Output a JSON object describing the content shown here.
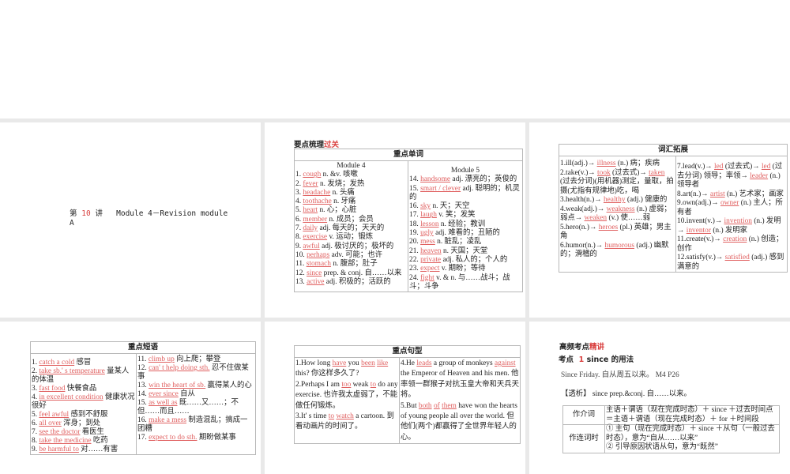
{
  "slide1": {
    "prefix": "第",
    "num": "10",
    "mid": "讲",
    "title": "Module 4－Revision module",
    "title2": "A"
  },
  "slide2": {
    "heading": "要点梳理",
    "heading_red": "过关",
    "table_title": "重点单词",
    "col1_head": "Module 4",
    "col2_head": "Module 5",
    "col1": [
      [
        {
          "t": "1. "
        },
        {
          "t": "cough",
          "r": 1
        },
        {
          "t": "  n. &v. 咳嗽"
        }
      ],
      [
        {
          "t": "2. "
        },
        {
          "t": "fever",
          "r": 1
        },
        {
          "t": "  n. 发烧；发热"
        }
      ],
      [
        {
          "t": "3. "
        },
        {
          "t": "headache",
          "r": 1
        },
        {
          "t": " n. 头痛"
        }
      ],
      [
        {
          "t": "4. "
        },
        {
          "t": "toothache",
          "r": 1
        },
        {
          "t": "  n. 牙痛"
        }
      ],
      [
        {
          "t": "5. "
        },
        {
          "t": "heart",
          "r": 1
        },
        {
          "t": "  n. 心；心脏"
        }
      ],
      [
        {
          "t": "6. "
        },
        {
          "t": "member",
          "r": 1
        },
        {
          "t": "  n. 成员；会员"
        }
      ],
      [
        {
          "t": "7. "
        },
        {
          "t": "daily",
          "r": 1
        },
        {
          "t": "  adj. 每天的；天天的"
        }
      ],
      [
        {
          "t": "8. "
        },
        {
          "t": "exercise",
          "r": 1
        },
        {
          "t": "  v. 运动；锻炼"
        }
      ],
      [
        {
          "t": "9. "
        },
        {
          "t": "awful",
          "r": 1
        },
        {
          "t": "  adj. 极讨厌的；极坏的"
        }
      ],
      [
        {
          "t": "10. "
        },
        {
          "t": "perhaps",
          "r": 1
        },
        {
          "t": "  adv. 可能；也许"
        }
      ],
      [
        {
          "t": "11. "
        },
        {
          "t": "stomach",
          "r": 1
        },
        {
          "t": "  n. 腹部；肚子"
        }
      ],
      [
        {
          "t": "12. "
        },
        {
          "t": "since",
          "r": 1
        },
        {
          "t": "  prep. & conj. 自……以来"
        }
      ],
      [
        {
          "t": "13. "
        },
        {
          "t": "active",
          "r": 1
        },
        {
          "t": "  adj. 积极的；活跃的"
        }
      ]
    ],
    "col2": [
      [
        {
          "t": "14. "
        },
        {
          "t": "handsome",
          "r": 1
        },
        {
          "t": "  adj. 漂亮的；英俊的"
        }
      ],
      [
        {
          "t": "15. "
        },
        {
          "t": "smart / clever",
          "r": 1
        },
        {
          "t": "  adj. 聪明的；机灵的"
        }
      ],
      [
        {
          "t": "16. "
        },
        {
          "t": "sky",
          "r": 1
        },
        {
          "t": "  n. 天；天空"
        }
      ],
      [
        {
          "t": "17. "
        },
        {
          "t": "laugh",
          "r": 1
        },
        {
          "t": "  v. 笑；发笑"
        }
      ],
      [
        {
          "t": "18. "
        },
        {
          "t": "lesson",
          "r": 1
        },
        {
          "t": "  n. 经验；教训"
        }
      ],
      [
        {
          "t": "19. "
        },
        {
          "t": "ugly",
          "r": 1
        },
        {
          "t": "  adj. 难看的；丑陋的"
        }
      ],
      [
        {
          "t": "20. "
        },
        {
          "t": "mess",
          "r": 1
        },
        {
          "t": "  n. 脏乱；凌乱"
        }
      ],
      [
        {
          "t": "21. "
        },
        {
          "t": "heaven",
          "r": 1
        },
        {
          "t": "  n. 天国；天堂"
        }
      ],
      [
        {
          "t": "22. "
        },
        {
          "t": "private",
          "r": 1
        },
        {
          "t": "  adj. 私人的；个人的"
        }
      ],
      [
        {
          "t": "23. "
        },
        {
          "t": "expect",
          "r": 1
        },
        {
          "t": "  v. 期盼；等待"
        }
      ],
      [
        {
          "t": "24. "
        },
        {
          "t": "fight",
          "r": 1
        },
        {
          "t": "  v. & n. 与……战斗；战斗；斗争"
        }
      ]
    ]
  },
  "slide3": {
    "table_title": "词汇拓展",
    "col1": [
      [
        {
          "t": "1.ill(adj.)→ "
        },
        {
          "t": "illness",
          "r": 1
        },
        {
          "t": " (n.) 病；疾病"
        }
      ],
      [
        {
          "t": "2.take(v.)→ "
        },
        {
          "t": "took",
          "r": 1
        },
        {
          "t": " (过去式)→ "
        },
        {
          "t": "taken",
          "r": 1
        },
        {
          "t": " (过去分词)(用机器)测定，量取，拍摄(尤指有规律地)吃，喝"
        }
      ],
      [
        {
          "t": "3.health(n.)→ "
        },
        {
          "t": "healthy",
          "r": 1
        },
        {
          "t": " (adj.) 健康的"
        }
      ],
      [
        {
          "t": "4.weak(adj.)→ "
        },
        {
          "t": "weakness",
          "r": 1
        },
        {
          "t": " (n.) 虚弱；弱点→ "
        },
        {
          "t": "weaken",
          "r": 1
        },
        {
          "t": " (v.) 使……弱"
        }
      ],
      [
        {
          "t": "5.hero(n.)→ "
        },
        {
          "t": "heroes",
          "r": 1
        },
        {
          "t": " (pl.) 英雄；男主角"
        }
      ],
      [
        {
          "t": "6.humor(n.)→ "
        },
        {
          "t": "humorous",
          "r": 1
        },
        {
          "t": " (adj.) 幽默的；滑稽的"
        }
      ]
    ],
    "col2": [
      [
        {
          "t": "7.lead(v.)→ "
        },
        {
          "t": "led",
          "r": 1
        },
        {
          "t": " (过去式)→ "
        },
        {
          "t": "led",
          "r": 1
        },
        {
          "t": " (过去分词) 领导；率领→ "
        },
        {
          "t": "leader",
          "r": 1
        },
        {
          "t": " (n.) 领导者"
        }
      ],
      [
        {
          "t": "8.art(n.)→ "
        },
        {
          "t": "artist",
          "r": 1
        },
        {
          "t": " (n.) 艺术家；画家"
        }
      ],
      [
        {
          "t": "9.own(adj.)→ "
        },
        {
          "t": "owner",
          "r": 1
        },
        {
          "t": " (n.) 主人；所有者"
        }
      ],
      [
        {
          "t": "10.invent(v.)→ "
        },
        {
          "t": "invention",
          "r": 1
        },
        {
          "t": " (n.) 发明→ "
        },
        {
          "t": "inventor",
          "r": 1
        },
        {
          "t": " (n.) 发明家"
        }
      ],
      [
        {
          "t": "11.create(v.)→ "
        },
        {
          "t": "creation",
          "r": 1
        },
        {
          "t": " (n.) 创造；创作"
        }
      ],
      [
        {
          "t": "12.satisfy(v.)→ "
        },
        {
          "t": "satisfied",
          "r": 1
        },
        {
          "t": " (adj.) 感到满意的"
        }
      ]
    ]
  },
  "slide4": {
    "table_title": "重点短语",
    "col1": [
      [
        {
          "t": "1. "
        },
        {
          "t": "catch a cold",
          "r": 1
        },
        {
          "t": "  感冒"
        }
      ],
      [
        {
          "t": "2. "
        },
        {
          "t": "take sb.' s temperature",
          "r": 1
        },
        {
          "t": " 量某人的体温"
        }
      ],
      [
        {
          "t": "3. "
        },
        {
          "t": "fast food",
          "r": 1
        },
        {
          "t": "  快餐食品"
        }
      ],
      [
        {
          "t": "4. "
        },
        {
          "t": "in excellent condition",
          "r": 1
        },
        {
          "t": " 健康状况很好"
        }
      ],
      [
        {
          "t": "5. "
        },
        {
          "t": "feel awful",
          "r": 1
        },
        {
          "t": "  感到不舒服"
        }
      ],
      [
        {
          "t": "6. "
        },
        {
          "t": "all over",
          "r": 1
        },
        {
          "t": "  浑身；到处"
        }
      ],
      [
        {
          "t": "7. "
        },
        {
          "t": "see the doctor",
          "r": 1
        },
        {
          "t": "  看医生"
        }
      ],
      [
        {
          "t": "8. "
        },
        {
          "t": "take the medicine",
          "r": 1
        },
        {
          "t": "  吃药"
        }
      ],
      [
        {
          "t": "9. "
        },
        {
          "t": "be harmful to",
          "r": 1
        },
        {
          "t": "  对……有害"
        }
      ]
    ],
    "col2": [
      [
        {
          "t": "11. "
        },
        {
          "t": "climb up",
          "r": 1
        },
        {
          "t": "  向上爬；攀登"
        }
      ],
      [
        {
          "t": "12. "
        },
        {
          "t": "can' t help doing sth.",
          "r": 1
        },
        {
          "t": " 忍不住做某事"
        }
      ],
      [
        {
          "t": "13. "
        },
        {
          "t": "win the heart of sb.",
          "r": 1
        },
        {
          "t": "  赢得某人的心"
        }
      ],
      [
        {
          "t": "14. "
        },
        {
          "t": "ever since",
          "r": 1
        },
        {
          "t": "  自从"
        }
      ],
      [
        {
          "t": "15. "
        },
        {
          "t": "as well as",
          "r": 1
        },
        {
          "t": "  既……又……；不但……而且……"
        }
      ],
      [
        {
          "t": "16. "
        },
        {
          "t": "make a mess",
          "r": 1
        },
        {
          "t": "  制造混乱；搞成一团糟"
        }
      ],
      [
        {
          "t": "17. "
        },
        {
          "t": "expect to do sth.",
          "r": 1
        },
        {
          "t": "  期盼做某事"
        }
      ]
    ]
  },
  "slide5": {
    "table_title": "重点句型",
    "col1": [
      [
        {
          "t": "1.How long  "
        },
        {
          "t": "have",
          "r": 1
        },
        {
          "t": "  you  "
        },
        {
          "t": "been",
          "r": 1
        },
        {
          "t": "   "
        },
        {
          "t": "like",
          "r": 1
        },
        {
          "t": "  this? 你这样多久了?"
        }
      ],
      [
        {
          "t": "2.Perhaps I am  "
        },
        {
          "t": "too",
          "r": 1
        },
        {
          "t": "  weak  "
        },
        {
          "t": "to",
          "r": 1
        },
        {
          "t": "  do any exercise. 也许我太虚弱了，不能做任何锻炼。"
        }
      ],
      [
        {
          "t": "3.It' s time  "
        },
        {
          "t": "to",
          "r": 1
        },
        {
          "t": "  "
        },
        {
          "t": "watch",
          "r": 1
        },
        {
          "t": "  a cartoon. 到看动画片的时间了。"
        }
      ]
    ],
    "col2": [
      [
        {
          "t": "4.He  "
        },
        {
          "t": "leads",
          "r": 1
        },
        {
          "t": "  a group of monkeys  "
        },
        {
          "t": "against",
          "r": 1
        },
        {
          "t": "  the Emperor of Heaven and his men. 他率领一群猴子对抗玉皇大帝和天兵天将。"
        }
      ],
      [
        {
          "t": "5.But "
        },
        {
          "t": "both",
          "r": 1
        },
        {
          "t": "   "
        },
        {
          "t": "of",
          "r": 1
        },
        {
          "t": "   "
        },
        {
          "t": "them",
          "r": 1
        },
        {
          "t": "  have won the hearts of young people all over the world. 但他们(两个)都赢得了全世界年轻人的心。"
        }
      ]
    ]
  },
  "slide6": {
    "heading": "高频考点",
    "heading_red": "精讲",
    "point_label": "考点",
    "point_num": "1",
    "point_title": "since 的用法",
    "example": "Since Friday. 自从周五以来。  M4 P26",
    "analysis": "【透析】  since prep.&conj. 自……以来。",
    "rows": [
      {
        "label": "作介词",
        "lines": [
          "主语＋谓语（现在完成时态）＋ since ＋过去时间点＝主语＋谓语（现在完成时态）＋ for ＋时间段"
        ]
      },
      {
        "label": "作连词时",
        "lines": [
          "① 主句（现在完成时态）＋ since ＋从句（一般过去时态），意为“自从……以来”",
          "② 引导原因状语从句，意为“既然”"
        ]
      }
    ]
  }
}
